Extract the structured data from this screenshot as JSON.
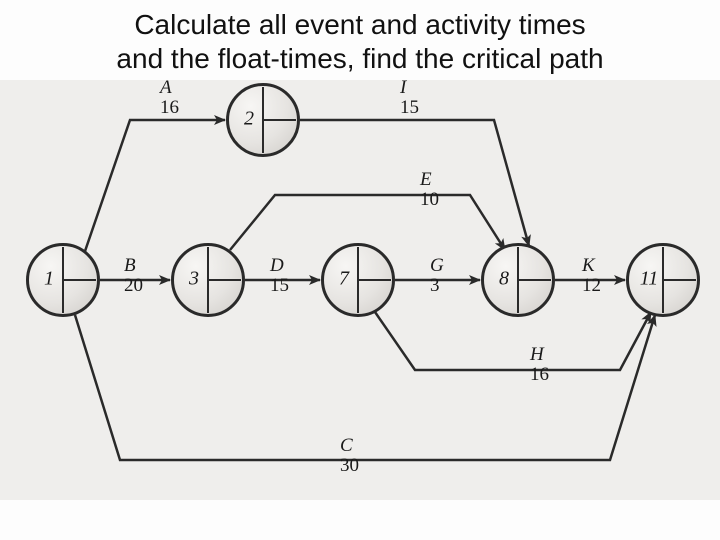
{
  "title_line1": "Calculate all event and activity times",
  "title_line2": "and the float-times, find the critical path",
  "nodes": {
    "n1": "1",
    "n2": "2",
    "n3": "3",
    "n7": "7",
    "n8": "8",
    "n11": "11"
  },
  "activities": {
    "A": {
      "label": "A",
      "duration": "16"
    },
    "B": {
      "label": "B",
      "duration": "20"
    },
    "C": {
      "label": "C",
      "duration": "30"
    },
    "D": {
      "label": "D",
      "duration": "15"
    },
    "E": {
      "label": "E",
      "duration": "10"
    },
    "G": {
      "label": "G",
      "duration": "3"
    },
    "H": {
      "label": "H",
      "duration": "16"
    },
    "I": {
      "label": "I",
      "duration": "15"
    },
    "K": {
      "label": "K",
      "duration": "12"
    }
  },
  "chart_data": {
    "type": "diagram",
    "network": "activity-on-arrow",
    "events": [
      1,
      2,
      3,
      7,
      8,
      11
    ],
    "arcs": [
      {
        "name": "A",
        "from": 1,
        "to": 2,
        "duration": 16
      },
      {
        "name": "B",
        "from": 1,
        "to": 3,
        "duration": 20
      },
      {
        "name": "C",
        "from": 1,
        "to": 11,
        "duration": 30
      },
      {
        "name": "D",
        "from": 3,
        "to": 7,
        "duration": 15
      },
      {
        "name": "E",
        "from": 3,
        "to": 8,
        "duration": 10
      },
      {
        "name": "G",
        "from": 7,
        "to": 8,
        "duration": 3
      },
      {
        "name": "H",
        "from": 7,
        "to": 11,
        "duration": 16
      },
      {
        "name": "I",
        "from": 2,
        "to": 8,
        "duration": 15
      },
      {
        "name": "K",
        "from": 8,
        "to": 11,
        "duration": 12
      }
    ]
  }
}
